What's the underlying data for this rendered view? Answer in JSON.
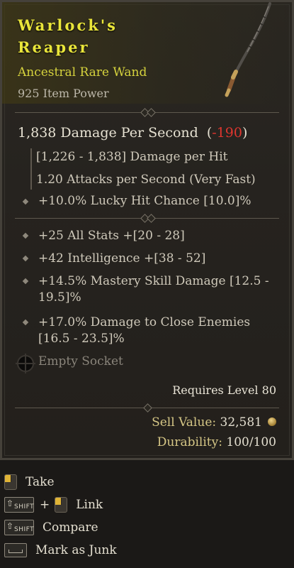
{
  "item": {
    "name_line1": "Warlock's",
    "name_line2": "Reaper",
    "type": "Ancestral Rare Wand",
    "item_power": "925 Item Power",
    "rarity_color": "#e9e53a"
  },
  "stats": {
    "dps_value": "1,838 Damage Per Second",
    "dps_change": "-190",
    "damage_per_hit": "[1,226 - 1,838] Damage per Hit",
    "attacks_per_second": "1.20 Attacks per Second (Very Fast)",
    "implicit": "+10.0% Lucky Hit Chance [10.0]%"
  },
  "affixes": [
    "+25 All Stats +[20 - 28]",
    "+42 Intelligence +[38 - 52]",
    "+14.5% Mastery Skill Damage [12.5 - 19.5]%",
    "+17.0% Damage to Close Enemies [16.5 - 23.5]%"
  ],
  "socket": {
    "label": "Empty Socket",
    "icon": "empty-socket-icon"
  },
  "requirements": {
    "level_text": "Requires Level 80"
  },
  "value": {
    "sell_label": "Sell Value:",
    "sell_amount": "32,581",
    "durability_label": "Durability:",
    "durability_amount": "100/100"
  },
  "actions": [
    {
      "key_icon": "left-mouse-icon",
      "label": "Take"
    },
    {
      "key_icon": "shift-key-icon",
      "key_text": "SHIFT",
      "plus": "+",
      "key2_icon": "left-mouse-icon",
      "label": "Link"
    },
    {
      "key_icon": "shift-key-icon",
      "key_text": "SHIFT",
      "label": "Compare"
    },
    {
      "key_icon": "spacebar-icon",
      "label": "Mark as Junk"
    }
  ]
}
